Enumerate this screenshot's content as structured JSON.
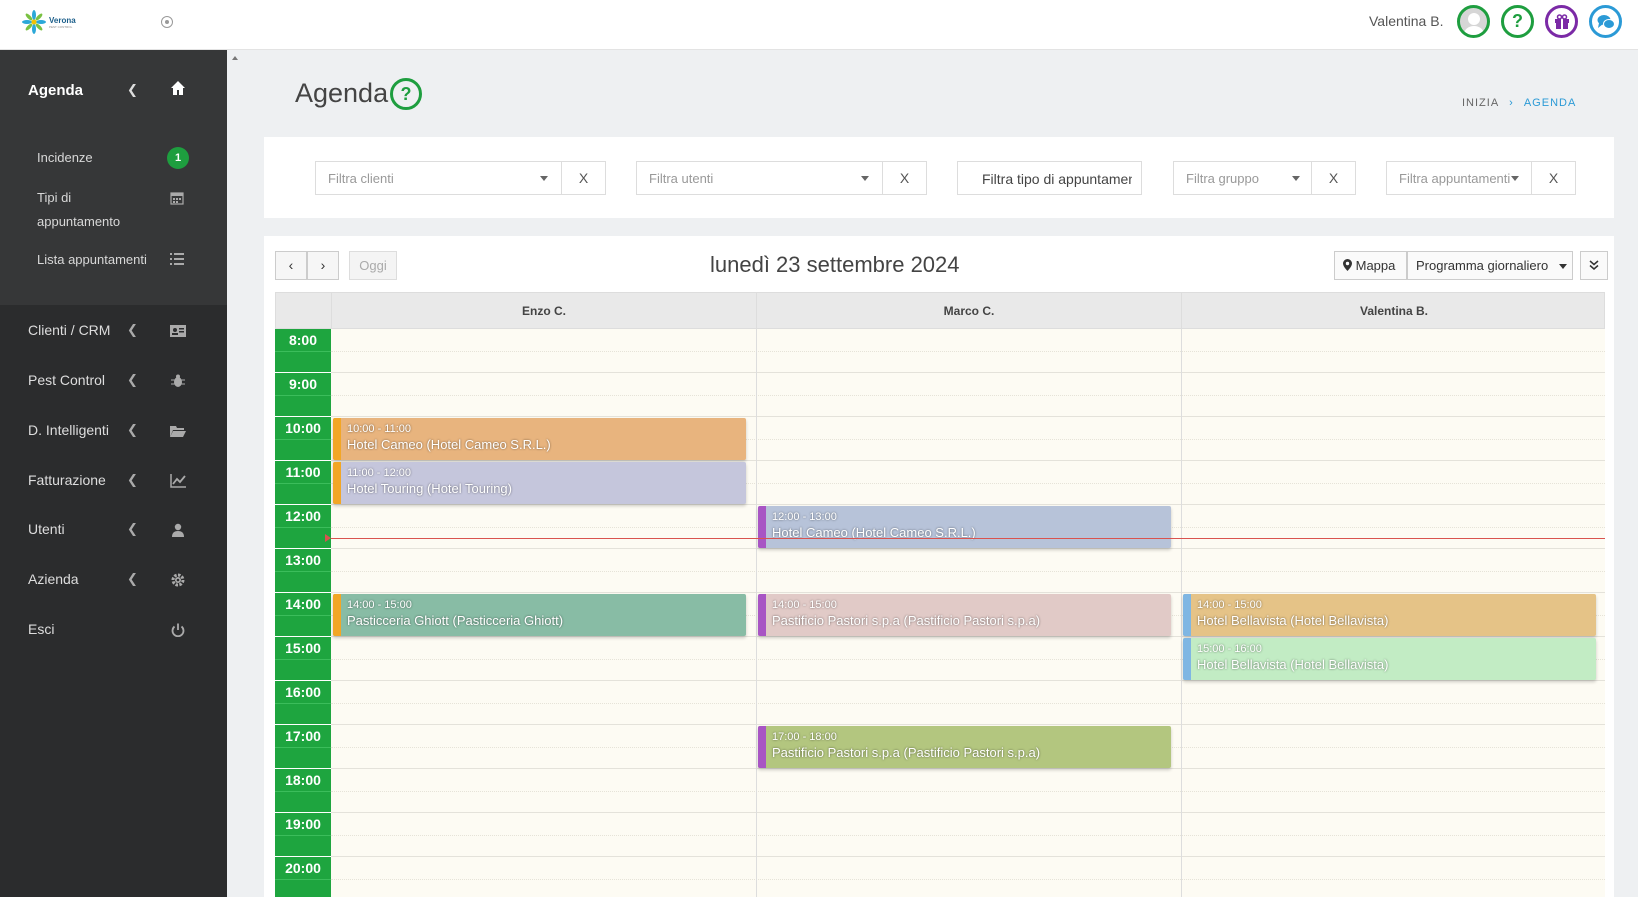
{
  "header": {
    "logo_text": "Verona",
    "logo_sub": "PEST CONTROL",
    "username": "Valentina B."
  },
  "sidebar": {
    "agenda_label": "Agenda",
    "sub_items": [
      {
        "label": "Incidenze",
        "badge": "1"
      },
      {
        "label": "Tipi di appuntamento"
      },
      {
        "label": "Lista appuntamenti"
      }
    ],
    "items": [
      {
        "label": "Clienti / CRM",
        "icon": "id-card-icon"
      },
      {
        "label": "Pest Control",
        "icon": "bug-icon"
      },
      {
        "label": "D. Intelligenti",
        "icon": "folder-open-icon"
      },
      {
        "label": "Fatturazione",
        "icon": "chart-line-icon"
      },
      {
        "label": "Utenti",
        "icon": "user-icon"
      },
      {
        "label": "Azienda",
        "icon": "gear-icon"
      },
      {
        "label": "Esci",
        "icon": "power-icon"
      }
    ]
  },
  "page": {
    "title": "Agenda",
    "breadcrumb": {
      "home": "INIZIA",
      "current": "AGENDA"
    }
  },
  "filters": {
    "clienti_placeholder": "Filtra clienti",
    "utenti_placeholder": "Filtra utenti",
    "tipo_placeholder": "Filtra tipo di appuntamento",
    "gruppo_placeholder": "Filtra gruppo",
    "appuntamenti_placeholder": "Filtra appuntamenti",
    "clear_label": "X"
  },
  "calendar": {
    "prev_label": "‹",
    "next_label": "›",
    "today_label": "Oggi",
    "date_title": "lunedì 23 settembre 2024",
    "map_label": "Mappa",
    "view_label": "Programma giornaliero",
    "columns": [
      "Enzo C.",
      "Marco C.",
      "Valentina B."
    ],
    "hours": [
      "8:00",
      "9:00",
      "10:00",
      "11:00",
      "12:00",
      "13:00",
      "14:00",
      "15:00",
      "16:00",
      "17:00",
      "18:00",
      "19:00",
      "20:00"
    ],
    "now": "12:45",
    "events": [
      {
        "column": 0,
        "start": "10:00",
        "end": "11:00",
        "time": "10:00 - 11:00",
        "title": "Hotel Cameo (Hotel Cameo S.R.L.)",
        "color": "#e8b47e",
        "bar": "#f2a626"
      },
      {
        "column": 0,
        "start": "11:00",
        "end": "12:00",
        "time": "11:00 - 12:00",
        "title": "Hotel Touring (Hotel Touring)",
        "color": "#c5c6dc",
        "bar": "#f2a626"
      },
      {
        "column": 0,
        "start": "14:00",
        "end": "15:00",
        "time": "14:00 - 15:00",
        "title": "Pasticceria Ghiott (Pasticceria Ghiott)",
        "color": "#88bca5",
        "bar": "#f2a626"
      },
      {
        "column": 1,
        "start": "12:00",
        "end": "13:00",
        "time": "12:00 - 13:00",
        "title": "Hotel Cameo (Hotel Cameo S.R.L.)",
        "color": "#b7c3d9",
        "bar": "#a855c4"
      },
      {
        "column": 1,
        "start": "14:00",
        "end": "15:00",
        "time": "14:00 - 15:00",
        "title": "Pastificio Pastori s.p.a (Pastificio Pastori s.p.a)",
        "color": "#e1cac7",
        "bar": "#a855c4"
      },
      {
        "column": 1,
        "start": "17:00",
        "end": "18:00",
        "time": "17:00 - 18:00",
        "title": "Pastificio Pastori s.p.a (Pastificio Pastori s.p.a)",
        "color": "#b3c67f",
        "bar": "#a855c4"
      },
      {
        "column": 2,
        "start": "14:00",
        "end": "15:00",
        "time": "14:00 - 15:00",
        "title": "Hotel Bellavista (Hotel Bellavista)",
        "color": "#e5c387",
        "bar": "#7fb6e3"
      },
      {
        "column": 2,
        "start": "15:00",
        "end": "16:00",
        "time": "15:00 - 16:00",
        "title": "Hotel Bellavista (Hotel Bellavista)",
        "color": "#c2ecc4",
        "bar": "#7fb6e3"
      }
    ]
  },
  "colors": {
    "accent_green": "#1e9e3f",
    "accent_blue": "#2b9ad6",
    "sidebar_bg": "#2b2c2d"
  }
}
